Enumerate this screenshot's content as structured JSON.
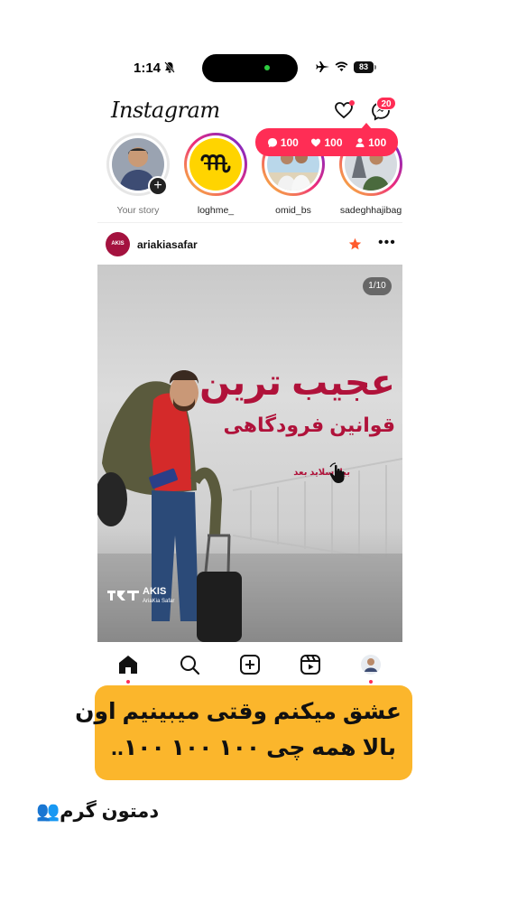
{
  "status_bar": {
    "time": "1:14",
    "battery": "83"
  },
  "header": {
    "logo": "Instagram",
    "messages_badge": "20"
  },
  "notification": {
    "comments": "100",
    "likes": "100",
    "followers": "100"
  },
  "stories": [
    {
      "name": "Your story"
    },
    {
      "name": "loghme_"
    },
    {
      "name": "omid_bs"
    },
    {
      "name": "sadeghhajibag"
    }
  ],
  "post": {
    "username": "ariakiasafar",
    "avatar_text": "AKIS",
    "slide_counter": "1/10",
    "headline": "عجیب ترین",
    "subheadline": "قوانین فرودگاهی",
    "swipe_hint": "بیا اسلاید بعد",
    "brand_name": "AKIS",
    "brand_sub": "AriaKia Safar"
  },
  "caption": {
    "line1": "عشق میکنم وقتی میبینیم اون",
    "line2": "بالا همه چی ۱۰۰ ۱۰۰ ۱۰۰.."
  },
  "footer": {
    "text": "دمتون گرم👥"
  },
  "colors": {
    "accent": "#ff2d55",
    "caption_bg": "#fbb62c",
    "headline": "#b0123a"
  }
}
